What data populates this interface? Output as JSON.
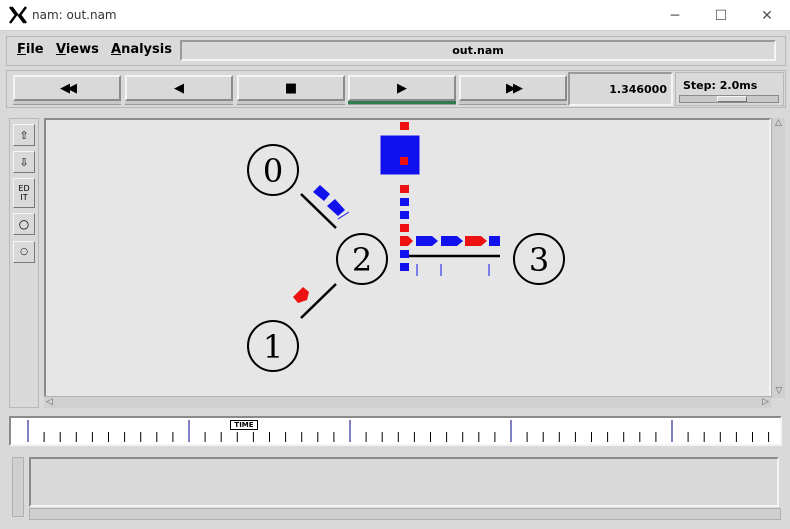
{
  "window": {
    "title": "nam: out.nam",
    "minimize_glyph": "─",
    "maximize_glyph": "☐",
    "close_glyph": "✕"
  },
  "menu": {
    "file": {
      "key": "F",
      "rest": "ile"
    },
    "views": {
      "key": "V",
      "rest": "iews"
    },
    "analysis": {
      "key": "A",
      "rest": "nalysis"
    },
    "filename": "out.nam"
  },
  "playback": {
    "rewind": "◀◀",
    "back": "◀",
    "stop": "■",
    "play": "▶",
    "fast_forward": "▶▶",
    "active": "play",
    "time": "1.346000",
    "step_label": "Step: 2.0ms"
  },
  "tools": {
    "zoom_in": "⇧",
    "zoom_out": "⇩",
    "edit": "ED\nIT",
    "circle_a": "○",
    "circle_b": "○"
  },
  "topology": {
    "nodes": [
      {
        "id": "0",
        "label": "0"
      },
      {
        "id": "1",
        "label": "1"
      },
      {
        "id": "2",
        "label": "2"
      },
      {
        "id": "3",
        "label": "3"
      }
    ],
    "colors": {
      "red": "#ee1111",
      "blue": "#1111ee",
      "link": "#000000"
    },
    "queue_colors": [
      "red",
      "red",
      "blue",
      "blue",
      "red",
      "blue",
      "blue",
      "blue"
    ]
  },
  "timeline": {
    "marker_label": "TIME",
    "major_tick_color": "#000088",
    "position": 0.305
  }
}
